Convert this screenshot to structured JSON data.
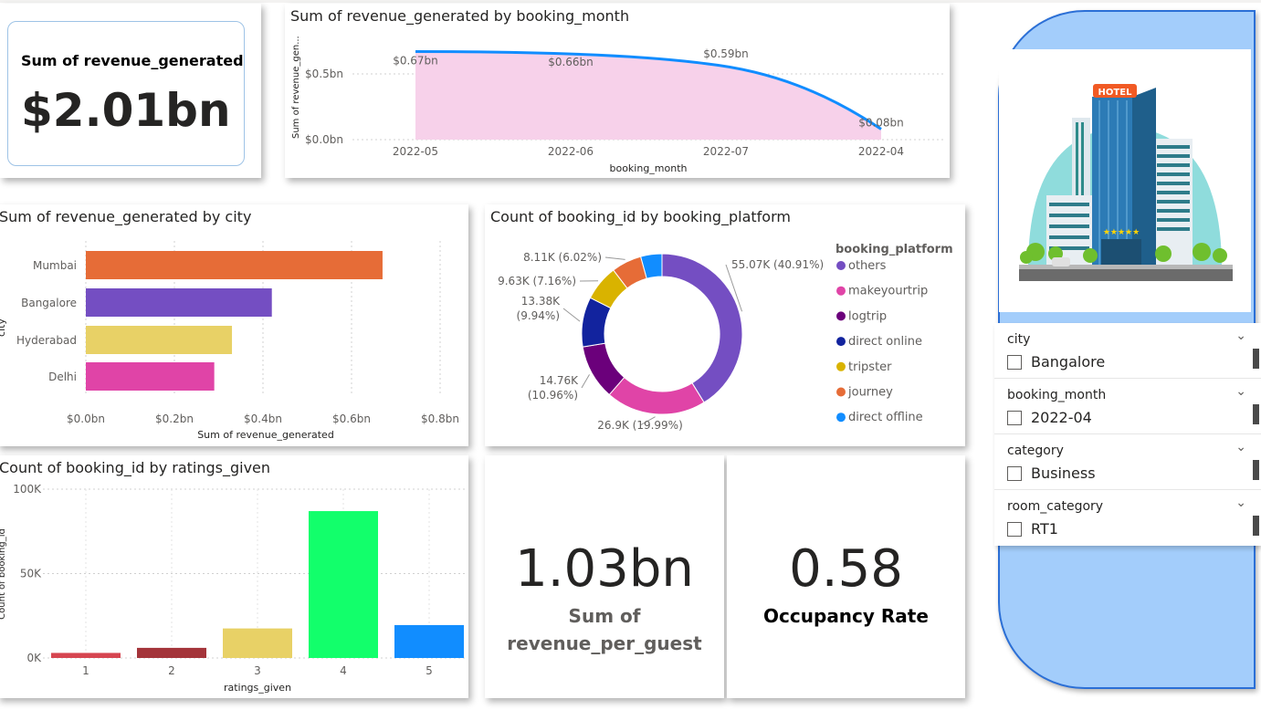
{
  "kpi_revenue": {
    "title": "Sum of revenue_generated",
    "value": "$2.01bn"
  },
  "line_chart": {
    "title": "Sum of revenue_generated by booking_month",
    "xlabel": "booking_month",
    "ylabel": "Sum of revenue_gen...",
    "y_ticks": [
      "$0.0bn",
      "$0.5bn"
    ],
    "chart_data": {
      "type": "area",
      "title": "Sum of revenue_generated by booking_month",
      "xlabel": "booking_month",
      "ylabel": "Sum of revenue_gen...",
      "categories": [
        "2022-05",
        "2022-06",
        "2022-07",
        "2022-04"
      ],
      "values": [
        0.67,
        0.66,
        0.59,
        0.08
      ],
      "value_labels": [
        "$0.67bn",
        "$0.66bn",
        "$0.59bn",
        "$0.08bn"
      ],
      "ylim": [
        0,
        0.7
      ],
      "grid": true,
      "colors": {
        "line": "#118dff",
        "fill": "#f7d1ea"
      }
    }
  },
  "bar_city": {
    "title": "Sum of revenue_generated by city",
    "xlabel": "Sum of revenue_generated",
    "ylabel": "city",
    "x_ticks": [
      "$0.0bn",
      "$0.2bn",
      "$0.4bn",
      "$0.6bn",
      "$0.8bn"
    ],
    "chart_data": {
      "type": "bar",
      "orientation": "horizontal",
      "title": "Sum of revenue_generated by city",
      "xlabel": "Sum of revenue_generated",
      "ylabel": "city",
      "categories": [
        "Mumbai",
        "Bangalore",
        "Hyderabad",
        "Delhi"
      ],
      "values": [
        0.67,
        0.42,
        0.33,
        0.29
      ],
      "xlim": [
        0,
        0.8
      ],
      "colors": [
        "#e66c37",
        "#744ec2",
        "#e8d166",
        "#e044a7"
      ]
    }
  },
  "donut": {
    "title": "Count of booking_id by booking_platform",
    "legend_title": "booking_platform",
    "chart_data": {
      "type": "pie",
      "subtype": "donut",
      "title": "Count of booking_id by booking_platform",
      "legend_title": "booking_platform",
      "legend_position": "right",
      "categories": [
        "others",
        "makeyourtrip",
        "logtrip",
        "direct online",
        "tripster",
        "journey",
        "direct offline"
      ],
      "values": [
        55066,
        26898,
        14756,
        13379,
        9630,
        8106,
        5710
      ],
      "percents": [
        40.91,
        19.99,
        10.96,
        9.94,
        7.16,
        6.02,
        4.24
      ],
      "labels": [
        "55.07K (40.91%)",
        "26.9K (19.99%)",
        "14.76K (10.96%)",
        "13.38K (9.94%)",
        "9.63K (7.16%)",
        "8.11K (6.02%)",
        ""
      ],
      "colors": [
        "#744ec2",
        "#e044a7",
        "#6b007b",
        "#12239e",
        "#d9b300",
        "#e66c37",
        "#118dff"
      ]
    }
  },
  "ratings": {
    "title": "Count of booking_id by ratings_given",
    "xlabel": "ratings_given",
    "ylabel": "Count of booking_id",
    "y_ticks": [
      "0K",
      "50K",
      "100K"
    ],
    "chart_data": {
      "type": "bar",
      "title": "Count of booking_id by ratings_given",
      "xlabel": "ratings_given",
      "ylabel": "Count of booking_id",
      "categories": [
        "1",
        "2",
        "3",
        "4",
        "5"
      ],
      "values": [
        3000,
        6000,
        17500,
        87000,
        19500
      ],
      "ylim": [
        0,
        100000
      ],
      "grid": true,
      "colors": [
        "#d64550",
        "#a4343a",
        "#e8d166",
        "#12ff6b",
        "#118dff"
      ]
    }
  },
  "kpi_rpg": {
    "value": "1.03bn",
    "label_line1": "Sum of",
    "label_line2": "revenue_per_guest"
  },
  "kpi_occ": {
    "value": "0.58",
    "label": "Occupancy Rate"
  },
  "hotel_image": {
    "sign": "HOTEL",
    "stars": "★★★★★"
  },
  "slicers": [
    {
      "header": "city",
      "option": "Bangalore"
    },
    {
      "header": "booking_month",
      "option": "2022-04"
    },
    {
      "header": "category",
      "option": "Business"
    },
    {
      "header": "room_category",
      "option": "RT1"
    }
  ]
}
